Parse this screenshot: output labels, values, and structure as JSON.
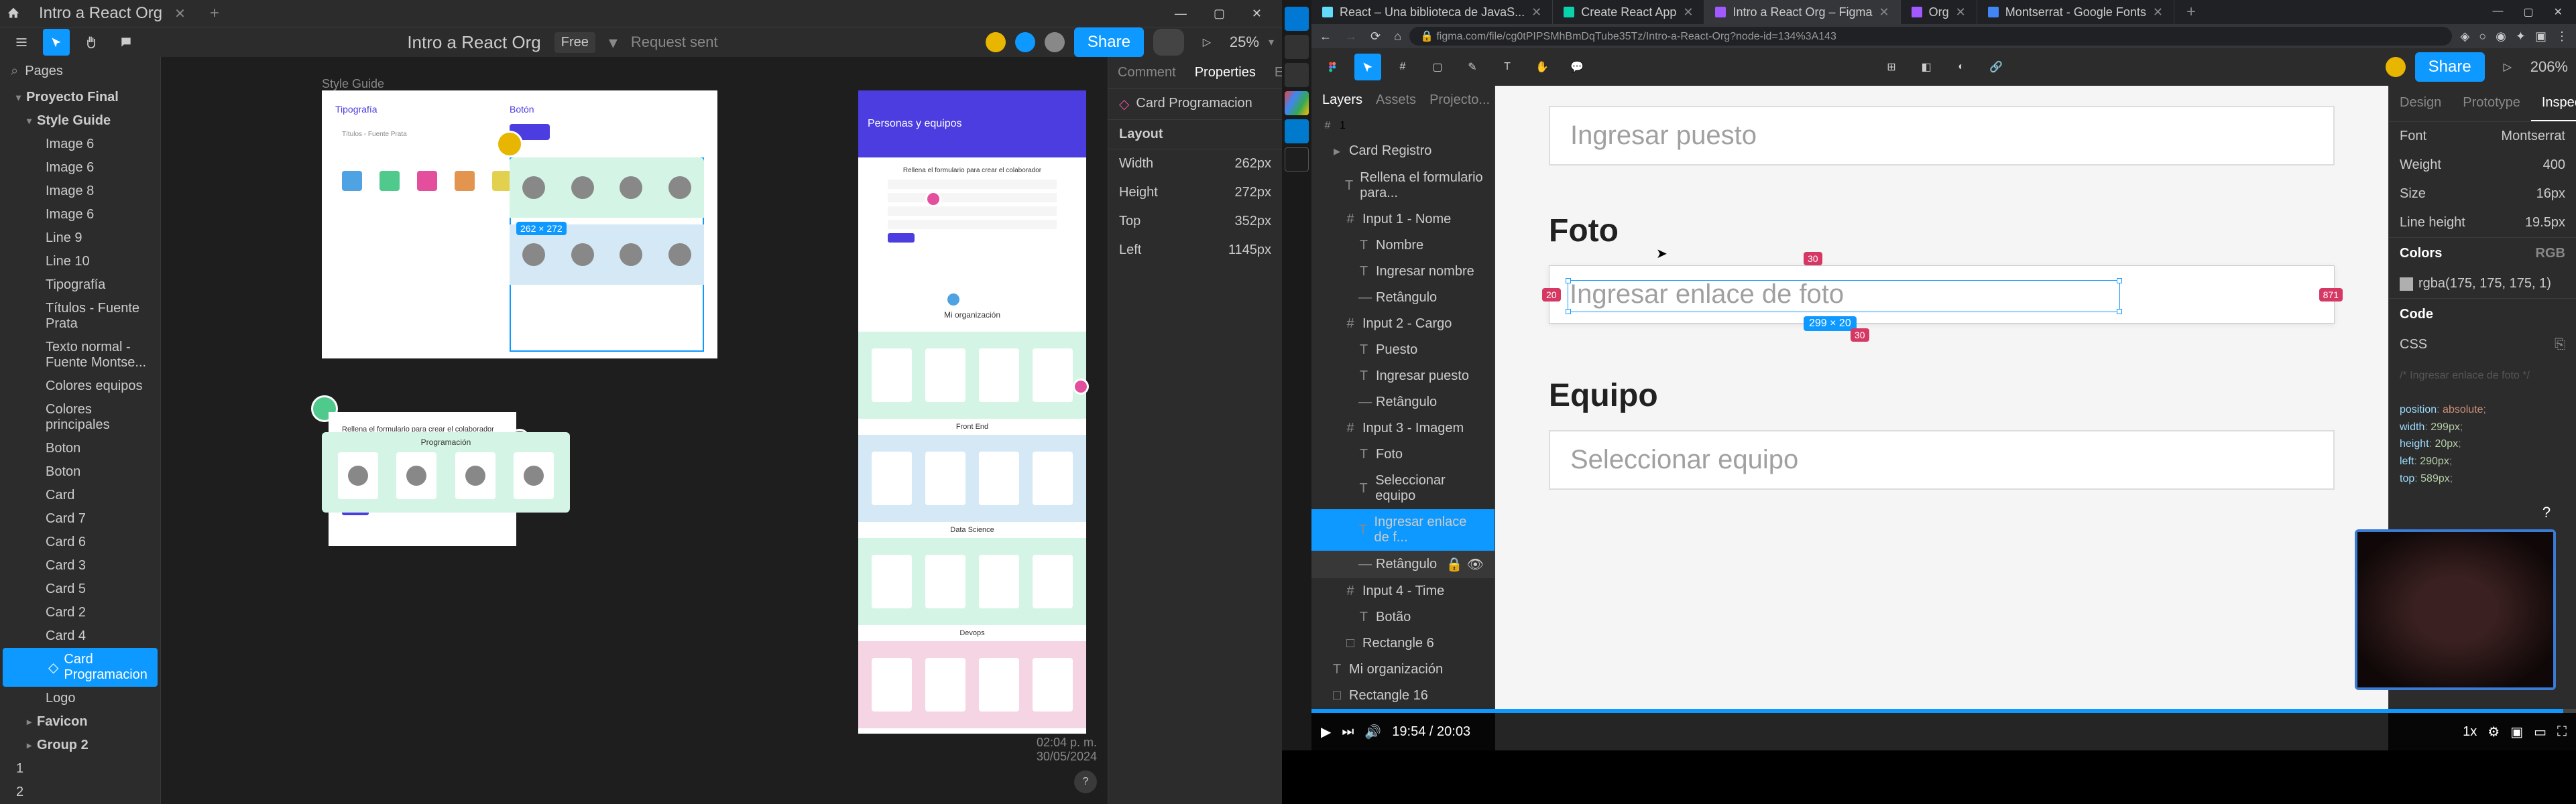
{
  "left": {
    "tab_title": "Intro a React Org",
    "doc_title": "Intro a React Org",
    "plan_badge": "Free",
    "request_sent": "Request sent",
    "share": "Share",
    "zoom": "25%",
    "pages_label": "Pages",
    "layers": {
      "proyecto_final": "Proyecto Final",
      "style_guide": "Style Guide",
      "items": [
        "Image 6",
        "Image 6",
        "Image 8",
        "Image 6",
        "Line 9",
        "Line 10",
        "Tipografía",
        "Títulos - Fuente Prata",
        "Texto normal - Fuente Montse...",
        "Colores equipos",
        "Colores principales",
        "Boton",
        "Boton",
        "Card",
        "Card 7",
        "Card 6",
        "Card 3",
        "Card 5",
        "Card 2",
        "Card 4",
        "Card Programacion",
        "Logo"
      ],
      "selected": "Card Programacion",
      "favicon": "Favicon",
      "group2": "Group 2",
      "n1": "1",
      "n2": "2"
    },
    "panel": {
      "tabs": [
        "Comment",
        "Properties",
        "Export"
      ],
      "layer_name": "Card Programacion",
      "layout": "Layout",
      "width_l": "Width",
      "width_v": "262px",
      "height_l": "Height",
      "height_v": "272px",
      "top_l": "Top",
      "top_v": "352px",
      "left_l": "Left",
      "left_v": "1145px"
    },
    "canvas": {
      "styleguide_label": "Style Guide",
      "sel_dim": "262 × 272",
      "tipografia": "Tipografía",
      "boton": "Botón",
      "formulario": "Rellena el formulario para crear el colaborador",
      "programacion": "Programación",
      "section_labels": [
        "Personas y equipos",
        "Mi organización",
        "Programación",
        "Front End",
        "Data Science",
        "Devops"
      ]
    },
    "clock": {
      "time": "02:04 p. m.",
      "date": "30/05/2024"
    }
  },
  "right": {
    "browser_tabs": [
      {
        "t": "React – Una biblioteca de JavaS..."
      },
      {
        "t": "Create React App"
      },
      {
        "t": "Intro a React Org – Figma",
        "active": true
      },
      {
        "t": "Org"
      },
      {
        "t": "Montserrat - Google Fonts"
      }
    ],
    "url": "figma.com/file/cg0tPIPSMhBmDqTube35Tz/Intro-a-React-Org?node-id=134%3A143",
    "figma": {
      "zoom": "206%",
      "share": "Share",
      "layer_tabs": [
        "Layers",
        "Assets",
        "Projecto..."
      ],
      "page_no": "1",
      "layers": [
        {
          "t": "Card Registro",
          "ind": 1
        },
        {
          "t": "Rellena el formulario para...",
          "ind": 2,
          "icon": "T"
        },
        {
          "t": "Input 1 - Nome",
          "ind": 2,
          "icon": "#"
        },
        {
          "t": "Nombre",
          "ind": 3,
          "icon": "T"
        },
        {
          "t": "Ingresar nombre",
          "ind": 3,
          "icon": "T"
        },
        {
          "t": "Retângulo",
          "ind": 3,
          "icon": "—"
        },
        {
          "t": "Input 2 - Cargo",
          "ind": 2,
          "icon": "#"
        },
        {
          "t": "Puesto",
          "ind": 3,
          "icon": "T"
        },
        {
          "t": "Ingresar puesto",
          "ind": 3,
          "icon": "T"
        },
        {
          "t": "Retângulo",
          "ind": 3,
          "icon": "—"
        },
        {
          "t": "Input 3 - Imagem",
          "ind": 2,
          "icon": "#"
        },
        {
          "t": "Foto",
          "ind": 3,
          "icon": "T"
        },
        {
          "t": "Seleccionar equipo",
          "ind": 3,
          "icon": "T"
        },
        {
          "t": "Ingresar enlace de f...",
          "ind": 3,
          "icon": "T",
          "sel": true
        },
        {
          "t": "Retângulo",
          "ind": 3,
          "icon": "—",
          "hover": true
        },
        {
          "t": "Input 4 - Time",
          "ind": 2,
          "icon": "#"
        },
        {
          "t": "Botão",
          "ind": 3,
          "icon": "T"
        },
        {
          "t": "Rectangle 6",
          "ind": 2,
          "icon": "□"
        },
        {
          "t": "Mi organización",
          "ind": 1,
          "icon": "T"
        },
        {
          "t": "Rectangle 16",
          "ind": 1,
          "icon": "□"
        }
      ],
      "canvas": {
        "puesto_ph": "Ingresar puesto",
        "foto_label": "Foto",
        "foto_ph": "Ingresar enlace de foto",
        "equipo_label": "Equipo",
        "equipo_ph": "Seleccionar equipo",
        "dim": "299 × 20",
        "dist30_1": "30",
        "dist30_2": "30",
        "dist20": "20",
        "dist871": "871"
      },
      "inspect": {
        "tabs": [
          "Design",
          "Prototype",
          "Inspect"
        ],
        "font_l": "Font",
        "font_v": "Montserrat",
        "weight_l": "Weight",
        "weight_v": "400",
        "size_l": "Size",
        "size_v": "16px",
        "lh_l": "Line height",
        "lh_v": "19.5px",
        "colors_h": "Colors",
        "colors_mode": "RGB",
        "color_val": "rgba(175, 175, 175, 1)",
        "code_h": "Code",
        "css": "CSS",
        "code_comment": "/* Ingresar enlace de foto */",
        "code_lines": [
          {
            "k": "position",
            "v": "absolute"
          },
          {
            "k": "width",
            "v": "299px"
          },
          {
            "k": "height",
            "v": "20px"
          },
          {
            "k": "left",
            "v": "290px"
          },
          {
            "k": "top",
            "v": "589px"
          }
        ]
      }
    },
    "youtube": {
      "time_cur": "19:54",
      "time_total": "20:03",
      "scale": "1x"
    }
  }
}
